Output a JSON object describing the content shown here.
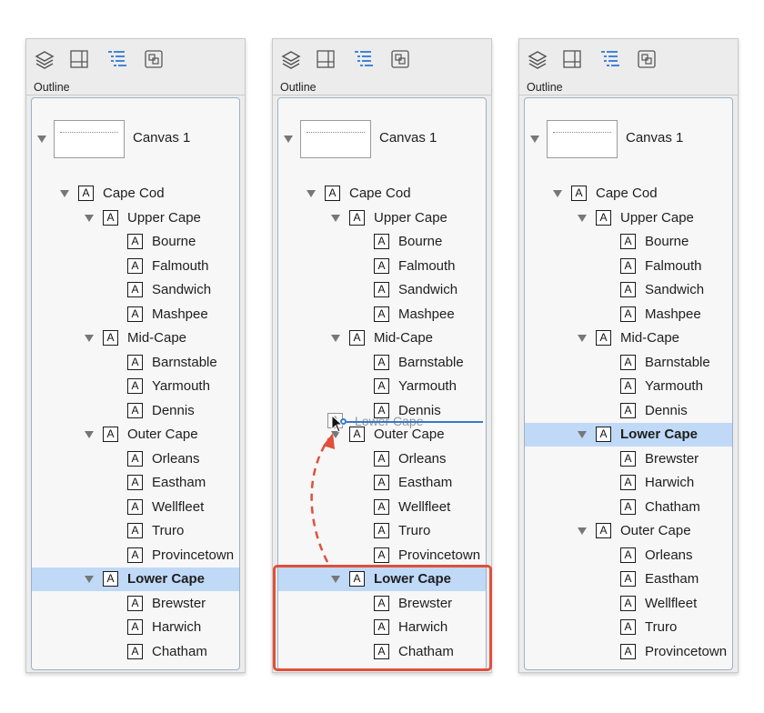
{
  "toolbar": {
    "icons": [
      "layers-icon",
      "canvas-grid-icon",
      "outline-icon",
      "objects-icon"
    ]
  },
  "panels": [
    {
      "header": "Outline",
      "canvas_label": "Canvas 1",
      "rows": [
        {
          "label": "Cape Cod",
          "level": 0,
          "expanded": true
        },
        {
          "label": "Upper Cape",
          "level": 1,
          "expanded": true
        },
        {
          "label": "Bourne",
          "level": 2
        },
        {
          "label": "Falmouth",
          "level": 2
        },
        {
          "label": "Sandwich",
          "level": 2
        },
        {
          "label": "Mashpee",
          "level": 2
        },
        {
          "label": "Mid-Cape",
          "level": 1,
          "expanded": true
        },
        {
          "label": "Barnstable",
          "level": 2
        },
        {
          "label": "Yarmouth",
          "level": 2
        },
        {
          "label": "Dennis",
          "level": 2
        },
        {
          "label": "Outer Cape",
          "level": 1,
          "expanded": true
        },
        {
          "label": "Orleans",
          "level": 2
        },
        {
          "label": "Eastham",
          "level": 2
        },
        {
          "label": "Wellfleet",
          "level": 2
        },
        {
          "label": "Truro",
          "level": 2
        },
        {
          "label": "Provincetown",
          "level": 2
        },
        {
          "label": "Lower Cape",
          "level": 1,
          "expanded": true,
          "selected": true
        },
        {
          "label": "Brewster",
          "level": 2
        },
        {
          "label": "Harwich",
          "level": 2
        },
        {
          "label": "Chatham",
          "level": 2
        }
      ]
    },
    {
      "header": "Outline",
      "canvas_label": "Canvas 1",
      "drag_ghost_label": "Lower Cape",
      "rows": [
        {
          "label": "Cape Cod",
          "level": 0,
          "expanded": true
        },
        {
          "label": "Upper Cape",
          "level": 1,
          "expanded": true
        },
        {
          "label": "Bourne",
          "level": 2
        },
        {
          "label": "Falmouth",
          "level": 2
        },
        {
          "label": "Sandwich",
          "level": 2
        },
        {
          "label": "Mashpee",
          "level": 2
        },
        {
          "label": "Mid-Cape",
          "level": 1,
          "expanded": true
        },
        {
          "label": "Barnstable",
          "level": 2
        },
        {
          "label": "Yarmouth",
          "level": 2
        },
        {
          "label": "Dennis",
          "level": 2
        },
        {
          "label": "Outer Cape",
          "level": 1,
          "expanded": true
        },
        {
          "label": "Orleans",
          "level": 2
        },
        {
          "label": "Eastham",
          "level": 2
        },
        {
          "label": "Wellfleet",
          "level": 2
        },
        {
          "label": "Truro",
          "level": 2
        },
        {
          "label": "Provincetown",
          "level": 2
        },
        {
          "label": "Lower Cape",
          "level": 1,
          "expanded": true,
          "selected": true
        },
        {
          "label": "Brewster",
          "level": 2
        },
        {
          "label": "Harwich",
          "level": 2
        },
        {
          "label": "Chatham",
          "level": 2
        }
      ]
    },
    {
      "header": "Outline",
      "canvas_label": "Canvas 1",
      "rows": [
        {
          "label": "Cape Cod",
          "level": 0,
          "expanded": true
        },
        {
          "label": "Upper Cape",
          "level": 1,
          "expanded": true
        },
        {
          "label": "Bourne",
          "level": 2
        },
        {
          "label": "Falmouth",
          "level": 2
        },
        {
          "label": "Sandwich",
          "level": 2
        },
        {
          "label": "Mashpee",
          "level": 2
        },
        {
          "label": "Mid-Cape",
          "level": 1,
          "expanded": true
        },
        {
          "label": "Barnstable",
          "level": 2
        },
        {
          "label": "Yarmouth",
          "level": 2
        },
        {
          "label": "Dennis",
          "level": 2
        },
        {
          "label": "Lower Cape",
          "level": 1,
          "expanded": true,
          "selected": true
        },
        {
          "label": "Brewster",
          "level": 2
        },
        {
          "label": "Harwich",
          "level": 2
        },
        {
          "label": "Chatham",
          "level": 2
        },
        {
          "label": "Outer Cape",
          "level": 1,
          "expanded": true
        },
        {
          "label": "Orleans",
          "level": 2
        },
        {
          "label": "Eastham",
          "level": 2
        },
        {
          "label": "Wellfleet",
          "level": 2
        },
        {
          "label": "Truro",
          "level": 2
        },
        {
          "label": "Provincetown",
          "level": 2
        }
      ]
    }
  ],
  "item_glyph": "A",
  "colors": {
    "selection": "#bfd9f7",
    "drop_indicator": "#3a78c8",
    "highlight_box": "#e0503a",
    "active_toolbar_icon": "#2f7ad6"
  }
}
